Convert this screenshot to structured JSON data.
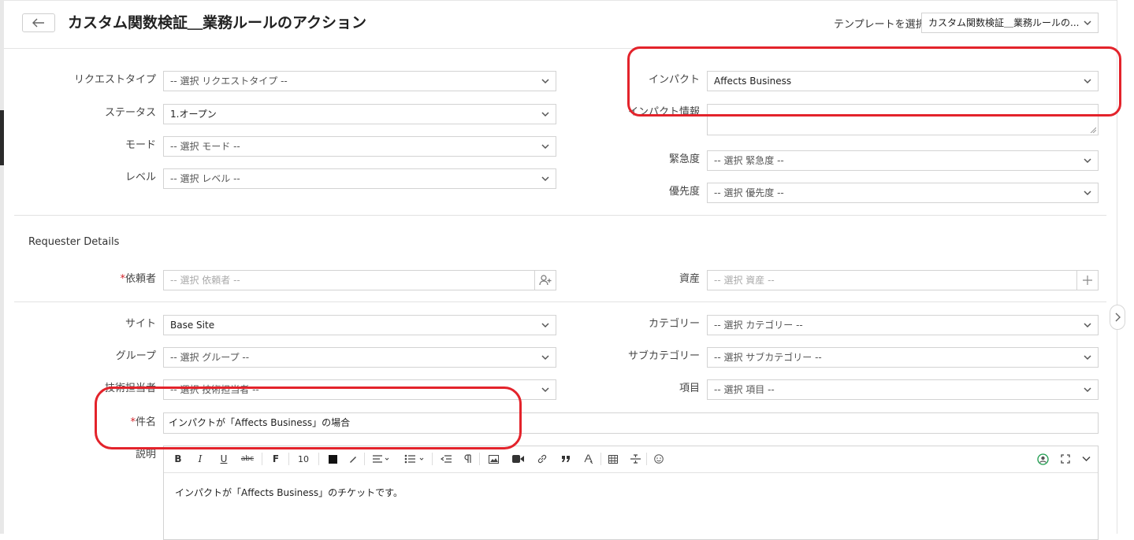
{
  "header": {
    "title": "カスタム関数検証＿業務ルールのアクション",
    "template_label": "テンプレートを選択",
    "template_value": "カスタム関数検証＿業務ルールの..."
  },
  "fields": {
    "request_type": {
      "label": "リクエストタイプ",
      "value": "-- 選択 リクエストタイプ --"
    },
    "status": {
      "label": "ステータス",
      "value": "1.オープン"
    },
    "mode": {
      "label": "モード",
      "value": "-- 選択 モード --"
    },
    "level": {
      "label": "レベル",
      "value": "-- 選択 レベル --"
    },
    "impact": {
      "label": "インパクト",
      "value": "Affects Business"
    },
    "impact_details": {
      "label": "インパクト情報",
      "value": ""
    },
    "urgency": {
      "label": "緊急度",
      "value": "-- 選択 緊急度 --"
    },
    "priority": {
      "label": "優先度",
      "value": "-- 選択 優先度 --"
    },
    "requester": {
      "label": "依頼者",
      "placeholder": "-- 選択 依頼者 --"
    },
    "asset": {
      "label": "資産",
      "placeholder": "-- 選択 資産 --"
    },
    "site": {
      "label": "サイト",
      "value": "Base Site"
    },
    "group": {
      "label": "グループ",
      "value": "-- 選択 グループ --"
    },
    "technician": {
      "label": "技術担当者",
      "value": "-- 選択 技術担当者 --"
    },
    "category": {
      "label": "カテゴリー",
      "value": "-- 選択 カテゴリー --"
    },
    "subcategory": {
      "label": "サブカテゴリー",
      "value": "-- 選択 サブカテゴリー --"
    },
    "item": {
      "label": "項目",
      "value": "-- 選択 項目 --"
    },
    "subject": {
      "label": "件名",
      "value": "インパクトが「Affects Business」の場合"
    },
    "description": {
      "label": "説明",
      "value": "インパクトが「Affects Business」のチケットです。"
    }
  },
  "requester_section": {
    "title": "Requester Details"
  },
  "required_mark": "*",
  "editor_toolbar": {
    "bold": "B",
    "italic": "I",
    "underline": "U",
    "strike": "abc",
    "font": "F",
    "font_size": "10"
  },
  "colors": {
    "highlight": "#e3232b",
    "required": "#d4232a",
    "border": "#d3d3d3"
  },
  "icons": [
    "back-arrow-icon",
    "chevron-down-icon",
    "add-user-icon",
    "plus-icon",
    "chevron-right-icon",
    "emoji-icon",
    "fullscreen-icon"
  ]
}
